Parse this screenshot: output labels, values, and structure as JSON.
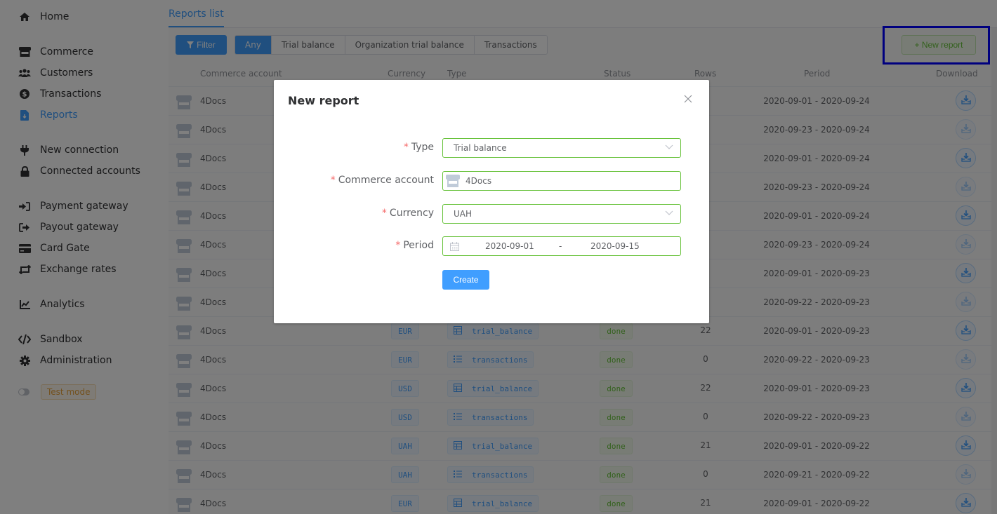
{
  "sidebar": {
    "items": [
      {
        "label": "Home",
        "icon": "home-icon"
      },
      {
        "label": "Commerce",
        "icon": "store-icon"
      },
      {
        "label": "Customers",
        "icon": "users-icon"
      },
      {
        "label": "Transactions",
        "icon": "dollar-circle-icon"
      },
      {
        "label": "Reports",
        "icon": "file-download-icon",
        "active": true
      },
      {
        "label": "New connection",
        "icon": "plug-icon"
      },
      {
        "label": "Connected accounts",
        "icon": "lock-icon"
      },
      {
        "label": "Payment gateway",
        "icon": "sign-in-icon"
      },
      {
        "label": "Payout gateway",
        "icon": "sign-out-icon"
      },
      {
        "label": "Card Gate",
        "icon": "credit-card-icon"
      },
      {
        "label": "Exchange rates",
        "icon": "retweet-icon"
      },
      {
        "label": "Analytics",
        "icon": "chart-line-icon"
      },
      {
        "label": "Sandbox",
        "icon": "code-icon"
      },
      {
        "label": "Administration",
        "icon": "gear-icon"
      }
    ],
    "test_mode_label": "Test mode"
  },
  "main": {
    "tab_label": "Reports list",
    "filter_label": "Filter",
    "type_filter": [
      "Any",
      "Trial balance",
      "Organization trial balance",
      "Transactions"
    ],
    "new_report_label": "+ New report",
    "columns": [
      "Commerce account",
      "Currency",
      "Type",
      "Status",
      "Rows",
      "Period",
      "Download"
    ],
    "rows": [
      {
        "account": "4Docs",
        "currency": "",
        "type": "",
        "status": "",
        "rows": "",
        "period": "2020-09-01 - 2020-09-24",
        "downloadable": true
      },
      {
        "account": "4Docs",
        "currency": "",
        "type": "",
        "status": "",
        "rows": "",
        "period": "2020-09-23 - 2020-09-24",
        "downloadable": false
      },
      {
        "account": "4Docs",
        "currency": "",
        "type": "",
        "status": "",
        "rows": "",
        "period": "2020-09-01 - 2020-09-24",
        "downloadable": true
      },
      {
        "account": "4Docs",
        "currency": "",
        "type": "",
        "status": "",
        "rows": "",
        "period": "2020-09-23 - 2020-09-24",
        "downloadable": false
      },
      {
        "account": "4Docs",
        "currency": "",
        "type": "",
        "status": "",
        "rows": "",
        "period": "2020-09-01 - 2020-09-24",
        "downloadable": true
      },
      {
        "account": "4Docs",
        "currency": "",
        "type": "",
        "status": "",
        "rows": "",
        "period": "2020-09-23 - 2020-09-24",
        "downloadable": false
      },
      {
        "account": "4Docs",
        "currency": "",
        "type": "",
        "status": "",
        "rows": "",
        "period": "2020-09-01 - 2020-09-23",
        "downloadable": true
      },
      {
        "account": "4Docs",
        "currency": "",
        "type": "",
        "status": "",
        "rows": "",
        "period": "2020-09-22 - 2020-09-23",
        "downloadable": false
      },
      {
        "account": "4Docs",
        "currency": "EUR",
        "type": "trial_balance",
        "status": "done",
        "rows": "22",
        "period": "2020-09-01 - 2020-09-23",
        "downloadable": true
      },
      {
        "account": "4Docs",
        "currency": "EUR",
        "type": "transactions",
        "status": "done",
        "rows": "0",
        "period": "2020-09-22 - 2020-09-23",
        "downloadable": false
      },
      {
        "account": "4Docs",
        "currency": "USD",
        "type": "trial_balance",
        "status": "done",
        "rows": "22",
        "period": "2020-09-01 - 2020-09-23",
        "downloadable": true
      },
      {
        "account": "4Docs",
        "currency": "USD",
        "type": "transactions",
        "status": "done",
        "rows": "0",
        "period": "2020-09-22 - 2020-09-23",
        "downloadable": false
      },
      {
        "account": "4Docs",
        "currency": "UAH",
        "type": "trial_balance",
        "status": "done",
        "rows": "21",
        "period": "2020-09-01 - 2020-09-22",
        "downloadable": true
      },
      {
        "account": "4Docs",
        "currency": "UAH",
        "type": "transactions",
        "status": "done",
        "rows": "0",
        "period": "2020-09-21 - 2020-09-22",
        "downloadable": false
      },
      {
        "account": "4Docs",
        "currency": "EUR",
        "type": "trial_balance",
        "status": "done",
        "rows": "21",
        "period": "2020-09-01 - 2020-09-22",
        "downloadable": true
      }
    ]
  },
  "modal": {
    "title": "New report",
    "fields": {
      "type": {
        "label": "Type",
        "value": "Trial balance"
      },
      "account": {
        "label": "Commerce account",
        "value": "4Docs"
      },
      "currency": {
        "label": "Currency",
        "value": "UAH"
      },
      "period": {
        "label": "Period",
        "start": "2020-09-01",
        "separator": "-",
        "end": "2020-09-15"
      }
    },
    "required_mark": "*",
    "create_label": "Create"
  },
  "colors": {
    "primary": "#409eff",
    "success": "#67c23a",
    "danger": "#f56c6c",
    "warning": "#e6a23c",
    "highlight": "#0000ff"
  }
}
